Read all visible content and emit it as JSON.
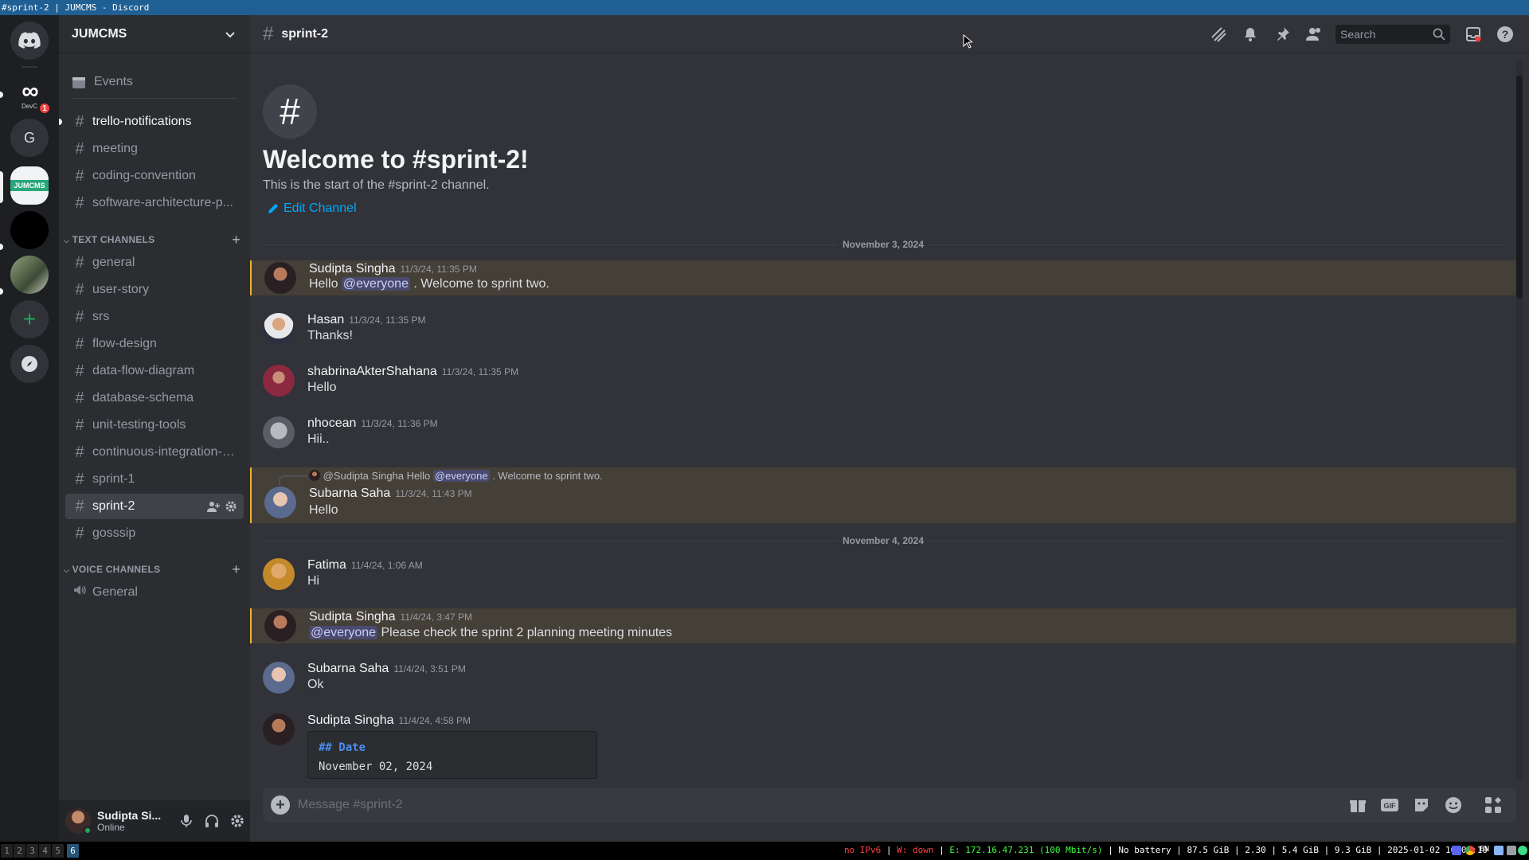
{
  "window": {
    "title": "#sprint-2 | JUMCMS - Discord"
  },
  "servers": {
    "items": [
      {
        "id": "home",
        "icon": "discord-icon"
      },
      {
        "id": "devc",
        "label": "DevC",
        "badge": "1"
      },
      {
        "id": "g",
        "label": "G"
      },
      {
        "id": "jumcms",
        "label": "JUMCMS",
        "active": true
      },
      {
        "id": "dark"
      },
      {
        "id": "photo"
      },
      {
        "id": "add",
        "icon": "plus-icon"
      },
      {
        "id": "explore",
        "icon": "compass-icon"
      }
    ]
  },
  "guild": {
    "name": "JUMCMS"
  },
  "sidebar": {
    "events_label": "Events",
    "top_channels": [
      "trello-notifications",
      "meeting",
      "coding-convention",
      "software-architecture-p..."
    ],
    "text_category": "TEXT CHANNELS",
    "text_channels": [
      "general",
      "user-story",
      "srs",
      "flow-design",
      "data-flow-diagram",
      "database-schema",
      "unit-testing-tools",
      "continuous-integration-t...",
      "sprint-1",
      "sprint-2",
      "gosssip"
    ],
    "voice_category": "VOICE CHANNELS",
    "voice_channels": [
      "General"
    ]
  },
  "user": {
    "name": "Sudipta Si...",
    "status": "Online"
  },
  "header": {
    "channel": "sprint-2",
    "search_placeholder": "Search"
  },
  "welcome": {
    "title": "Welcome to #sprint-2!",
    "subtitle": "This is the start of the #sprint-2 channel.",
    "edit": "Edit Channel"
  },
  "dividers": [
    "November 3, 2024",
    "November 4, 2024"
  ],
  "messages": [
    {
      "author": "Sudipta Singha",
      "time": "11/3/24, 11:35 PM",
      "pre": "Hello ",
      "mention": "@everyone",
      "post": " . Welcome to sprint two."
    },
    {
      "author": "Hasan",
      "time": "11/3/24, 11:35 PM",
      "text": "Thanks!"
    },
    {
      "author": "shabrinaAkterShahana",
      "time": "11/3/24, 11:35 PM",
      "text": "Hello"
    },
    {
      "author": "nhocean",
      "time": "11/3/24, 11:36 PM",
      "text": "Hii.."
    },
    {
      "reply_author": "@Sudipta Singha",
      "reply_pre": "Hello ",
      "reply_mention": "@everyone",
      "reply_post": " . Welcome to sprint two.",
      "author": "Subarna Saha",
      "time": "11/3/24, 11:43 PM",
      "text": "Hello"
    },
    {
      "author": "Fatima",
      "time": "11/4/24, 1:06 AM",
      "text": "Hi"
    },
    {
      "author": "Sudipta Singha",
      "time": "11/4/24, 3:47 PM",
      "mention": "@everyone",
      "post": " Please check the sprint 2 planning meeting minutes"
    },
    {
      "author": "Subarna Saha",
      "time": "11/4/24, 3:51 PM",
      "text": "Ok"
    },
    {
      "author": "Sudipta Singha",
      "time": "11/4/24, 4:58 PM",
      "code_heading": "## Date",
      "code_line": "November 02, 2024"
    }
  ],
  "composer": {
    "placeholder": "Message #sprint-2"
  },
  "taskbar": {
    "workspaces": [
      "1",
      "2",
      "3",
      "4",
      "5",
      "6"
    ],
    "active_workspace": "6",
    "status": {
      "ipv6": "no IPv6",
      "wifi": "W: down",
      "eth": "E: 172.16.47.231 (100 Mbit/s)",
      "battery": "No battery",
      "disk": "87.5 GiB",
      "load": "2.30",
      "mem": "5.4 GiB | 9.3 GiB",
      "datetime": "2025-01-02 16:07:10",
      "lang": "EN"
    }
  },
  "colors": {
    "accent": "#5865f2",
    "link": "#00a8fc",
    "mention_bar": "#f0b132",
    "online": "#23a55a"
  }
}
